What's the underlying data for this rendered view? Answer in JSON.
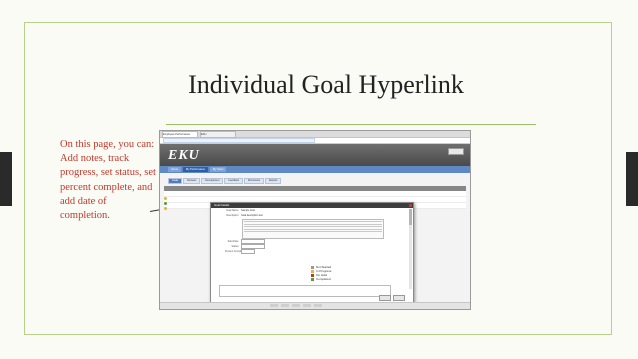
{
  "slide": {
    "title": "Individual Goal Hyperlink",
    "callout": "On this page, you can: Add notes, track progress, set status, set percent complete, and add date of completion."
  },
  "screenshot": {
    "logo": "EKU",
    "browser_tabs": [
      "Employee Performance",
      "EKU"
    ],
    "nav_tabs": [
      "Home",
      "My Performance",
      "My Team"
    ],
    "subtabs": [
      "Goals",
      "Reviews",
      "Development",
      "Feedback",
      "Documents",
      "Reports"
    ],
    "modal": {
      "title": "Goal Details",
      "rows": [
        {
          "label": "Goal Name:",
          "value": "Sample Goal"
        },
        {
          "label": "Description:",
          "value": "Goal description text"
        },
        {
          "label": "Start Date:",
          "value": "01/01/2015"
        },
        {
          "label": "Status:",
          "value": "In Progress"
        },
        {
          "label": "Percent Complete:",
          "value": "25%"
        }
      ],
      "legend": [
        "Not Started",
        "In Progress",
        "On Hold",
        "Completed"
      ],
      "notes_label": "Notes"
    }
  },
  "colors": {
    "frame": "#b9d08a",
    "callout_text": "#c0392b",
    "nav": "#5f89c5",
    "header": "#4a4a4a"
  }
}
